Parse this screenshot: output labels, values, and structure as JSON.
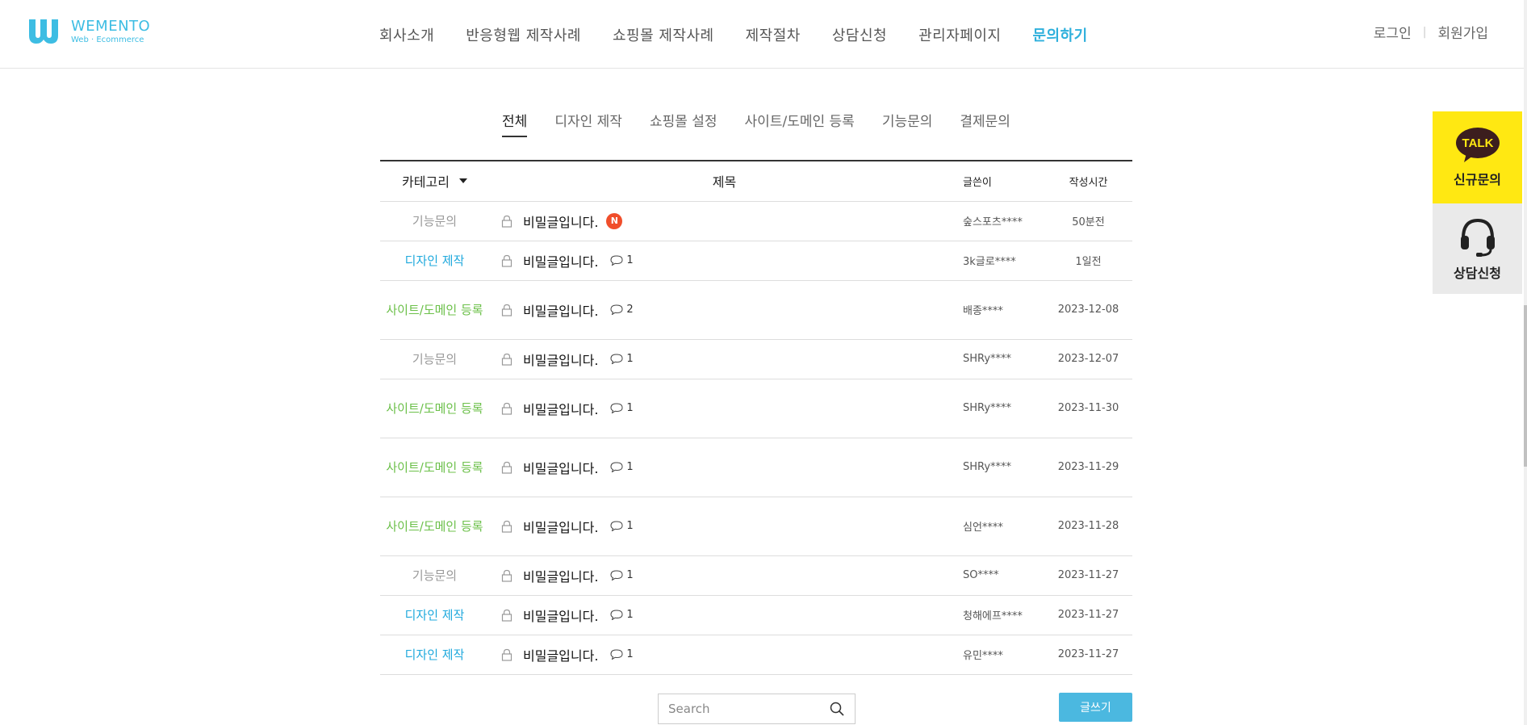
{
  "header": {
    "logo_name": "WEMENTO",
    "logo_sub": "Web · Ecommerce",
    "nav": [
      "회사소개",
      "반응형웹 제작사례",
      "쇼핑몰 제작사례",
      "제작절차",
      "상담신청",
      "관리자페이지",
      "문의하기"
    ],
    "active_nav": "문의하기",
    "login": "로그인",
    "signup": "회원가입",
    "separator": "|"
  },
  "tabs": [
    "전체",
    "디자인 제작",
    "쇼핑몰 설정",
    "사이트/도메인 등록",
    "기능문의",
    "결제문의"
  ],
  "active_tab": "전체",
  "board": {
    "columns": {
      "category": "카테고리",
      "subject": "제목",
      "writer": "글쓴이",
      "date": "작성시간"
    },
    "rows": [
      {
        "category": "기능문의",
        "cat_type": "func",
        "title": "비밀글입니다.",
        "new": "N",
        "comments": "",
        "writer": "숲스포츠****",
        "date": "50분전"
      },
      {
        "category": "디자인 제작",
        "cat_type": "design",
        "title": "비밀글입니다.",
        "new": "",
        "comments": "1",
        "writer": "3k글로****",
        "date": "1일전"
      },
      {
        "category": "사이트/도메인 등록",
        "cat_type": "site",
        "title": "비밀글입니다.",
        "new": "",
        "comments": "2",
        "writer": "배종****",
        "date": "2023-12-08"
      },
      {
        "category": "기능문의",
        "cat_type": "func",
        "title": "비밀글입니다.",
        "new": "",
        "comments": "1",
        "writer": "SHRy****",
        "date": "2023-12-07"
      },
      {
        "category": "사이트/도메인 등록",
        "cat_type": "site",
        "title": "비밀글입니다.",
        "new": "",
        "comments": "1",
        "writer": "SHRy****",
        "date": "2023-11-30"
      },
      {
        "category": "사이트/도메인 등록",
        "cat_type": "site",
        "title": "비밀글입니다.",
        "new": "",
        "comments": "1",
        "writer": "SHRy****",
        "date": "2023-11-29"
      },
      {
        "category": "사이트/도메인 등록",
        "cat_type": "site",
        "title": "비밀글입니다.",
        "new": "",
        "comments": "1",
        "writer": "심언****",
        "date": "2023-11-28"
      },
      {
        "category": "기능문의",
        "cat_type": "func",
        "title": "비밀글입니다.",
        "new": "",
        "comments": "1",
        "writer": "SO****",
        "date": "2023-11-27"
      },
      {
        "category": "디자인 제작",
        "cat_type": "design",
        "title": "비밀글입니다.",
        "new": "",
        "comments": "1",
        "writer": "청해에프****",
        "date": "2023-11-27"
      },
      {
        "category": "디자인 제작",
        "cat_type": "design",
        "title": "비밀글입니다.",
        "new": "",
        "comments": "1",
        "writer": "유민****",
        "date": "2023-11-27"
      }
    ]
  },
  "search": {
    "placeholder": "Search",
    "value": ""
  },
  "write_button": "글쓰기",
  "side": {
    "talk_icon_text": "TALK",
    "talk_label": "신규문의",
    "consult_label": "상담신청"
  },
  "colors": {
    "brand": "#3dbde3",
    "active_nav": "#2fb0dc",
    "design": "#1fa9dd",
    "site": "#6cc04a",
    "func": "#999999",
    "new_badge": "#f04e2b",
    "kakao": "#ffe812",
    "write_button": "#4bb8e0"
  }
}
